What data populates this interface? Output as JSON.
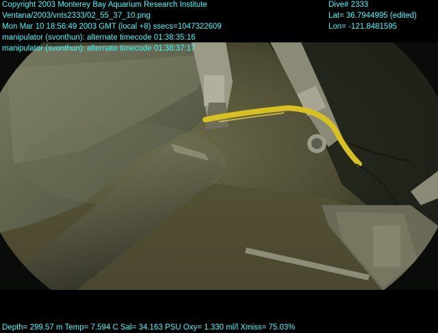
{
  "overlay": {
    "left_lines": [
      "Copyright 2003 Monterey Bay Aquarium Research Institute",
      "Ventana/2003/vnts2333/02_55_37_10.png",
      "Mon Mar 10 18:56:49 2003 GMT (local +8)  ssecs=1047322609",
      "manipulator (svonthun): alternate timecode 01:38:35:16",
      "manipulator (svonthun): alternate timecode 01:38:37:17"
    ],
    "right_lines": [
      "Dive# 2333",
      "Lat= 36.7944995 (edited)",
      "Lon= -121.8481595"
    ],
    "bottom_line": "Depth= 299.57 m  Temp= 7.594 C  Sal= 34.163 PSU  Oxy= 1.330 ml/l  Xmiss= 75.03%"
  },
  "colors": {
    "overlay_text": "#33ffff",
    "water": "#4a4a2c",
    "sediment": "#5a5840",
    "pipe": "#5e5c48",
    "hose": "#d8c020"
  }
}
